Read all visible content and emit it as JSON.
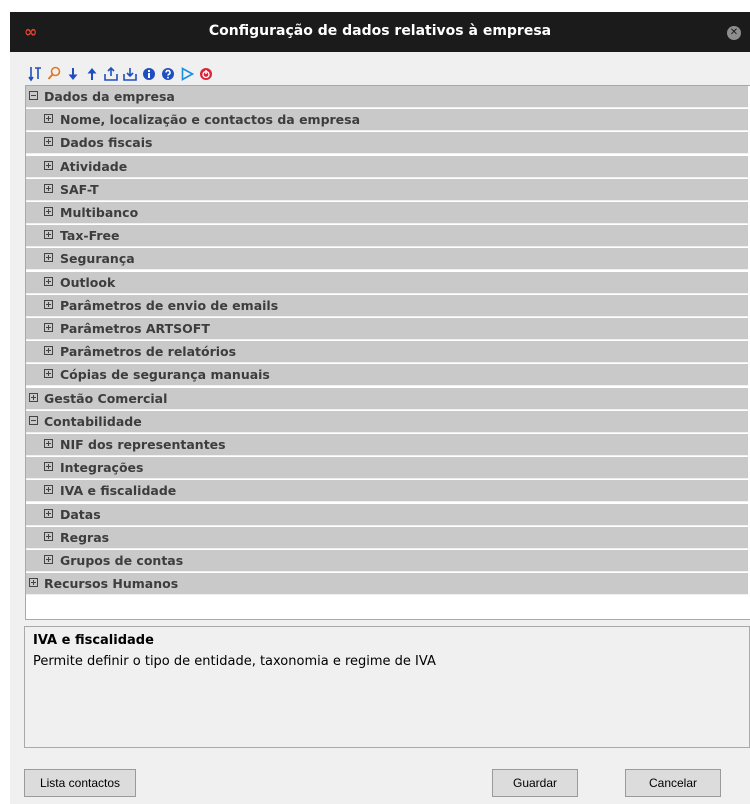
{
  "window": {
    "title": "Configuração de dados relativos à empresa",
    "logo": "∞"
  },
  "toolbar": {
    "icons": [
      "sort-icon",
      "search-icon",
      "arrow-down-icon",
      "arrow-up-icon",
      "export-icon",
      "import-icon",
      "info-icon",
      "help-icon",
      "play-icon",
      "power-icon"
    ]
  },
  "tree": {
    "rows": [
      {
        "label": "Dados da empresa",
        "level": 0,
        "expanded": true
      },
      {
        "label": "Nome, localização e contactos da empresa",
        "level": 1,
        "expanded": false
      },
      {
        "label": "Dados fiscais",
        "level": 1,
        "expanded": false
      },
      {
        "label": "Atividade",
        "level": 1,
        "expanded": false
      },
      {
        "label": "SAF-T",
        "level": 1,
        "expanded": false
      },
      {
        "label": "Multibanco",
        "level": 1,
        "expanded": false
      },
      {
        "label": "Tax-Free",
        "level": 1,
        "expanded": false
      },
      {
        "label": "Segurança",
        "level": 1,
        "expanded": false
      },
      {
        "label": "Outlook",
        "level": 1,
        "expanded": false
      },
      {
        "label": "Parâmetros de envio de emails",
        "level": 1,
        "expanded": false
      },
      {
        "label": "Parâmetros ARTSOFT",
        "level": 1,
        "expanded": false
      },
      {
        "label": "Parâmetros de relatórios",
        "level": 1,
        "expanded": false
      },
      {
        "label": "Cópias de segurança manuais",
        "level": 1,
        "expanded": false
      },
      {
        "label": "Gestão Comercial",
        "level": 0,
        "expanded": false
      },
      {
        "label": "Contabilidade",
        "level": 0,
        "expanded": true
      },
      {
        "label": "NIF dos representantes",
        "level": 1,
        "expanded": false
      },
      {
        "label": "Integrações",
        "level": 1,
        "expanded": false
      },
      {
        "label": "IVA e fiscalidade",
        "level": 1,
        "expanded": false
      },
      {
        "label": "Datas",
        "level": 1,
        "expanded": false
      },
      {
        "label": "Regras",
        "level": 1,
        "expanded": false
      },
      {
        "label": "Grupos de contas",
        "level": 1,
        "expanded": false
      },
      {
        "label": "Recursos Humanos",
        "level": 0,
        "expanded": false
      }
    ]
  },
  "description": {
    "title": "IVA e fiscalidade",
    "text": "Permite definir o tipo de entidade, taxonomia e regime de IVA"
  },
  "buttons": {
    "contacts": "Lista contactos",
    "save": "Guardar",
    "cancel": "Cancelar"
  }
}
